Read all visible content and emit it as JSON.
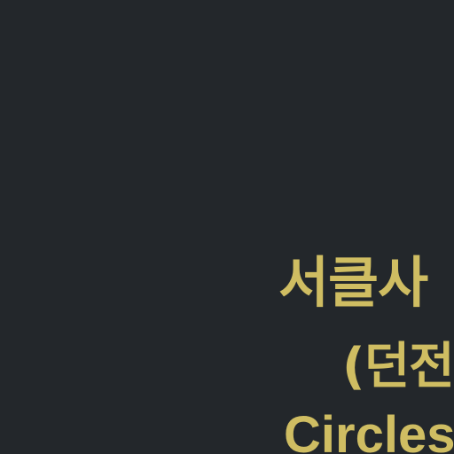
{
  "theme": {
    "background": "#23272b",
    "text_color": "#cfbd62"
  },
  "title": {
    "line1": "서클사",
    "line2": "(던전",
    "line3": "Circles"
  }
}
